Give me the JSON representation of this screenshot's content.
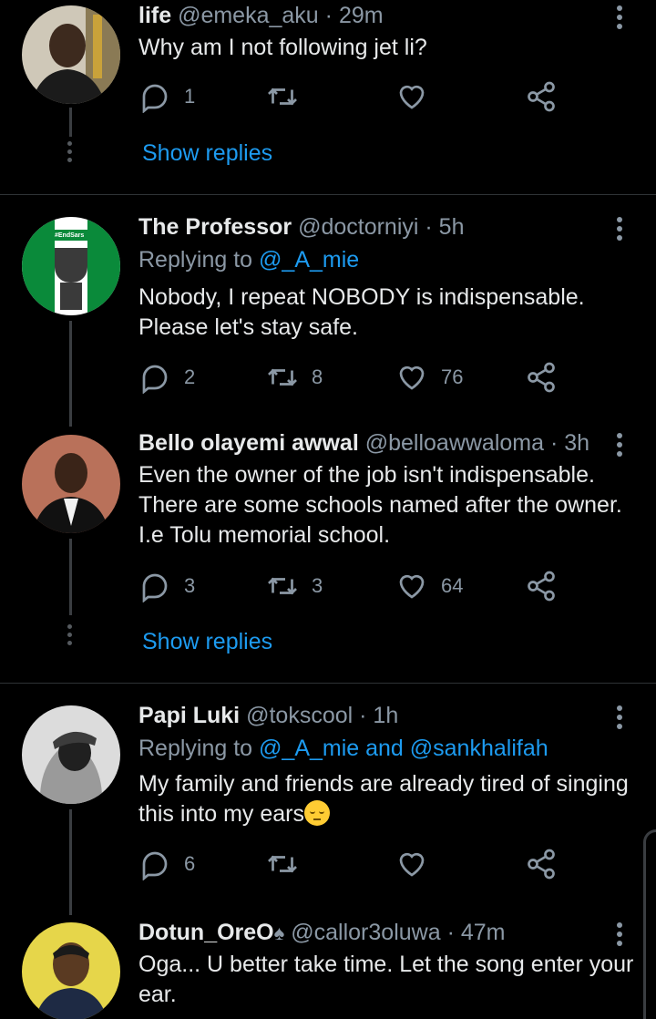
{
  "tweets": [
    {
      "name": "life",
      "handle": "@emeka_aku",
      "time": "· 29m",
      "text": "Why am I not following jet li?",
      "replies": "1",
      "retweets": "",
      "likes": "",
      "show_replies": "Show replies"
    },
    {
      "name": "The Professor",
      "handle": "@doctorniyi",
      "time": "· 5h",
      "replying_prefix": "Replying to",
      "replying_to": "@_A_mie",
      "text": "Nobody, I repeat NOBODY is indispensable. Please let's stay safe.",
      "replies": "2",
      "retweets": "8",
      "likes": "76",
      "avatar_label": "#EndSars"
    },
    {
      "name": "Bello olayemi awwal",
      "handle": "@belloawwaloma",
      "time": "· 3h",
      "text": "Even the owner of the job isn't indispensable. There are some schools named after the owner. I.e Tolu memorial school.",
      "replies": "3",
      "retweets": "3",
      "likes": "64",
      "show_replies": "Show replies"
    },
    {
      "name": "Papi Luki",
      "handle": "@tokscool",
      "time": "· 1h",
      "replying_prefix": "Replying to",
      "replying_to": "@_A_mie and @sankhalifah",
      "text": "My family and friends are already tired of singing this into my ears",
      "replies": "6",
      "retweets": "",
      "likes": ""
    },
    {
      "name": "Dotun_OreO",
      "handle": "@callor3oluwa",
      "time": "· 47m",
      "text": "Oga... U better take time. Let the song enter your ear."
    }
  ],
  "icons": {
    "reply": "reply-icon",
    "retweet": "retweet-icon",
    "like": "heart-icon",
    "share": "share-icon",
    "more": "more-vertical-icon"
  },
  "colors": {
    "background": "#000000",
    "text": "#e7e9ea",
    "muted": "#8b98a5",
    "link": "#1d9bf0"
  }
}
